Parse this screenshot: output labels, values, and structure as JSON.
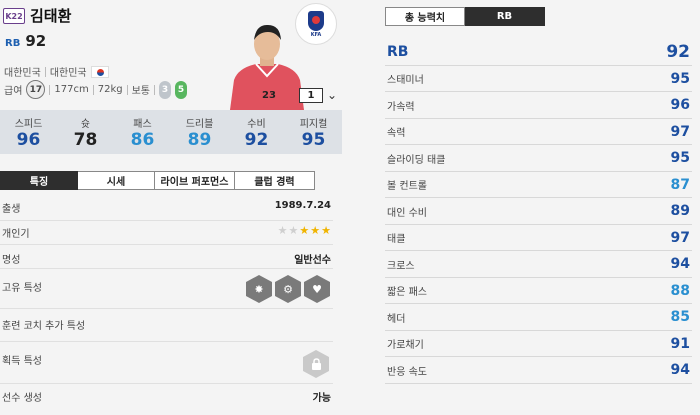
{
  "player": {
    "season_badge": "K22",
    "name": "김태환",
    "position": "RB",
    "overall": "92",
    "nation": "대한민국",
    "club": "대한민국",
    "pay_label": "급여",
    "pay": "17",
    "height": "177cm",
    "weight": "72kg",
    "build": "보통",
    "weak_foot": "3",
    "strong_foot": "5",
    "level": "1",
    "team_logo_text": "KFA"
  },
  "summary_stats": [
    {
      "label": "스피드",
      "value": "96",
      "color": "#1d4fa0"
    },
    {
      "label": "슛",
      "value": "78",
      "color": "#222222"
    },
    {
      "label": "패스",
      "value": "86",
      "color": "#2a8fd0"
    },
    {
      "label": "드리블",
      "value": "89",
      "color": "#2a8fd0"
    },
    {
      "label": "수비",
      "value": "92",
      "color": "#1d4fa0"
    },
    {
      "label": "피지컬",
      "value": "95",
      "color": "#1d4fa0"
    }
  ],
  "tabs": [
    "특징",
    "시세",
    "라이브 퍼포먼스",
    "클럽 경력"
  ],
  "details": {
    "birth_label": "출생",
    "birth_value": "1989.7.24",
    "popularity_label": "개인기",
    "popularity_stars": 3,
    "popularity_max": 5,
    "reputation_label": "명성",
    "reputation_value": "일반선수",
    "traits_label": "고유 특성",
    "coach_traits_label": "훈련 코치 추가 특성",
    "acquired_traits_label": "획득 특성",
    "creation_label": "선수 생성",
    "creation_value": "가능"
  },
  "right_tabs": [
    "총 능력치",
    "RB"
  ],
  "position_rating": {
    "name": "RB",
    "value": "92"
  },
  "attributes": [
    {
      "name": "스태미너",
      "value": "95"
    },
    {
      "name": "가속력",
      "value": "96"
    },
    {
      "name": "속력",
      "value": "97"
    },
    {
      "name": "슬라이딩 태클",
      "value": "95"
    },
    {
      "name": "볼 컨트롤",
      "value": "87"
    },
    {
      "name": "대인 수비",
      "value": "89"
    },
    {
      "name": "태클",
      "value": "97"
    },
    {
      "name": "크로스",
      "value": "94"
    },
    {
      "name": "짧은 패스",
      "value": "88"
    },
    {
      "name": "헤더",
      "value": "85"
    },
    {
      "name": "가로채기",
      "value": "91"
    },
    {
      "name": "반응 속도",
      "value": "94"
    }
  ],
  "colors": {
    "dark_blue": "#1d4fa0",
    "light_blue": "#2a8fd0",
    "star_gold": "#f0b400",
    "star_empty": "#cfcfcf"
  }
}
